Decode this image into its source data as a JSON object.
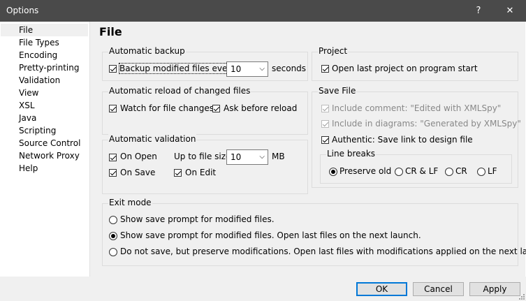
{
  "window": {
    "title": "Options",
    "help_label": "?",
    "close_label": "✕"
  },
  "sidebar": {
    "items": [
      "File",
      "File Types",
      "Encoding",
      "Pretty-printing",
      "Validation",
      "View",
      "XSL",
      "Java",
      "Scripting",
      "Source Control",
      "Network Proxy",
      "Help"
    ],
    "selected": "File"
  },
  "page_title": "File",
  "backup": {
    "title": "Automatic backup",
    "checkbox_label": "Backup modified files every",
    "interval_value": "10",
    "unit": "seconds",
    "checked": true
  },
  "project": {
    "title": "Project",
    "open_last_label": "Open last project on program start",
    "checked": true
  },
  "reload": {
    "title": "Automatic reload of changed files",
    "watch_label": "Watch for file changes",
    "ask_label": "Ask before reload"
  },
  "save_file": {
    "title": "Save File",
    "comment_label": "Include comment: \"Edited with XMLSpy\"",
    "diagrams_label": "Include in diagrams: \"Generated by XMLSpy\"",
    "authentic_label": "Authentic: Save link to design file"
  },
  "validation": {
    "title": "Automatic validation",
    "on_open_label": "On Open",
    "on_save_label": "On Save",
    "on_edit_label": "On Edit",
    "size_label": "Up to file size",
    "size_value": "10",
    "size_unit": "MB"
  },
  "line_breaks": {
    "title": "Line breaks",
    "options": [
      "Preserve old",
      "CR & LF",
      "CR",
      "LF"
    ],
    "selected": "Preserve old"
  },
  "exit_mode": {
    "title": "Exit mode",
    "options": [
      "Show save prompt for modified files.",
      "Show save prompt for modified files. Open last files on the next launch.",
      "Do not save, but preserve modifications. Open last files with modifications applied on the next launch."
    ],
    "selected": 1
  },
  "buttons": {
    "ok": "OK",
    "cancel": "Cancel",
    "apply": "Apply"
  }
}
